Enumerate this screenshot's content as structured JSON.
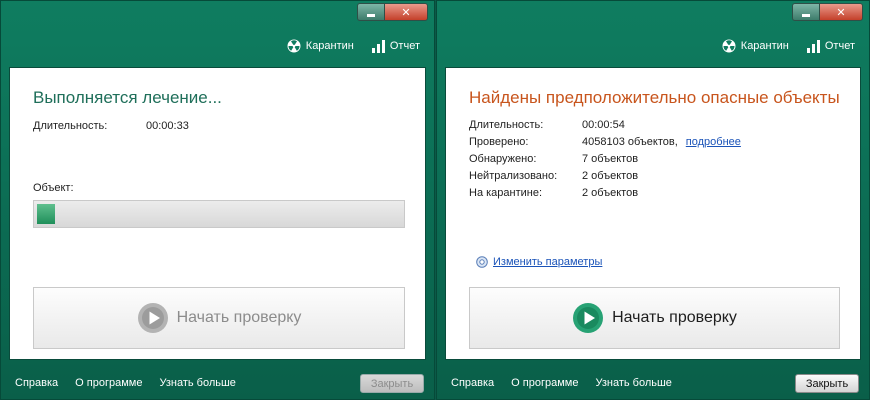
{
  "left_window": {
    "toolbar": {
      "quarantine": "Карантин",
      "report": "Отчет"
    },
    "title": "Выполняется лечение...",
    "duration_label": "Длительность:",
    "duration_value": "00:00:33",
    "object_label": "Объект:",
    "progress_fraction": 0.05,
    "start_button": "Начать проверку",
    "start_button_enabled": false,
    "footer": {
      "help": "Справка",
      "about": "О программе",
      "learn_more": "Узнать больше"
    },
    "close_button": "Закрыть",
    "close_button_enabled": false
  },
  "right_window": {
    "toolbar": {
      "quarantine": "Карантин",
      "report": "Отчет"
    },
    "title": "Найдены предположительно опасные объекты",
    "stats": {
      "duration_label": "Длительность:",
      "duration_value": "00:00:54",
      "scanned_label": "Проверено:",
      "scanned_value": "4058103 объектов,",
      "details_link": "подробнее",
      "detected_label": "Обнаружено:",
      "detected_value": "7 объектов",
      "neutralized_label": "Нейтрализовано:",
      "neutralized_value": "2 объектов",
      "quarantined_label": "На карантине:",
      "quarantined_value": "2 объектов"
    },
    "settings_link": "Изменить параметры",
    "start_button": "Начать проверку",
    "start_button_enabled": true,
    "footer": {
      "help": "Справка",
      "about": "О программе",
      "learn_more": "Узнать больше"
    },
    "close_button": "Закрыть",
    "close_button_enabled": true
  },
  "icons": {
    "quarantine": "radiation-icon",
    "report": "bar-chart-icon",
    "play": "play-icon",
    "settings": "gear-icon"
  },
  "colors": {
    "window_green": "#0f7d60",
    "title_in_progress": "#1f6f5a",
    "title_threats": "#c8551d",
    "link": "#1a53b8"
  }
}
